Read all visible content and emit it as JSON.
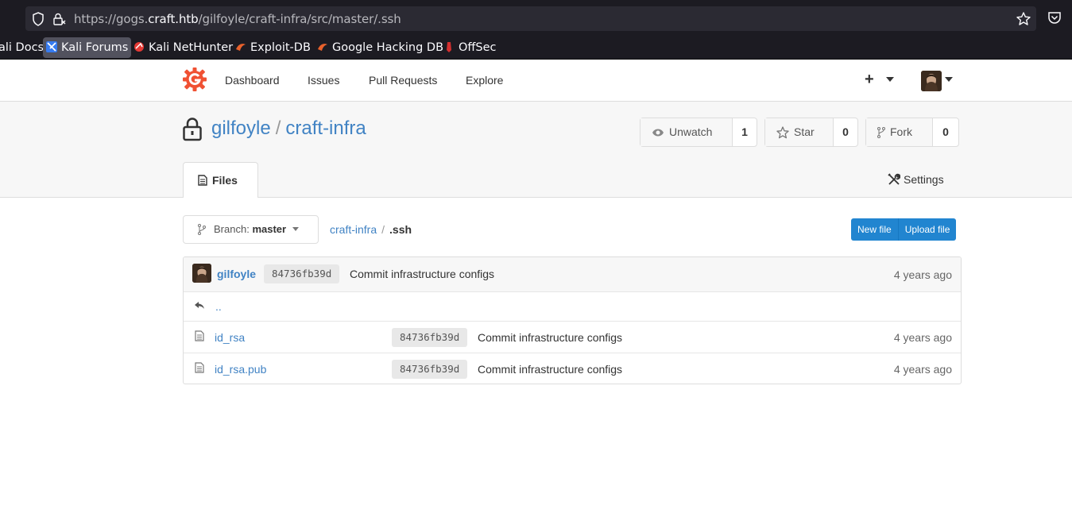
{
  "browser": {
    "url_prefix": "https://gogs.",
    "url_host": "craft.htb",
    "url_path": "/gilfoyle/craft-infra/src/master/.ssh",
    "bookmarks": [
      "ali Docs",
      "Kali Forums",
      "Kali NetHunter",
      "Exploit-DB",
      "Google Hacking DB",
      "OffSec"
    ]
  },
  "header": {
    "nav": [
      "Dashboard",
      "Issues",
      "Pull Requests",
      "Explore"
    ],
    "plus": "+"
  },
  "repo": {
    "owner": "gilfoyle",
    "separator": "/",
    "name": "craft-infra",
    "watch_label": "Unwatch",
    "watch_count": "1",
    "star_label": "Star",
    "star_count": "0",
    "fork_label": "Fork",
    "fork_count": "0",
    "tab_files": "Files",
    "tab_settings": "Settings"
  },
  "toolbar": {
    "branch_prefix": "Branch:",
    "branch_name": "master",
    "crumb_root": "craft-infra",
    "crumb_sep": "/",
    "crumb_current": ".ssh",
    "new_file": "New file",
    "upload_file": "Upload file"
  },
  "latest_commit": {
    "author": "gilfoyle",
    "sha": "84736fb39d",
    "message": "Commit infrastructure configs",
    "age": "4 years ago"
  },
  "parent_dir": "..",
  "files": [
    {
      "name": "id_rsa",
      "sha": "84736fb39d",
      "message": "Commit infrastructure configs",
      "age": "4 years ago"
    },
    {
      "name": "id_rsa.pub",
      "sha": "84736fb39d",
      "message": "Commit infrastructure configs",
      "age": "4 years ago"
    }
  ],
  "colors": {
    "link": "#4183c4",
    "primary_button": "#2185d0",
    "logo": "#f05133"
  }
}
